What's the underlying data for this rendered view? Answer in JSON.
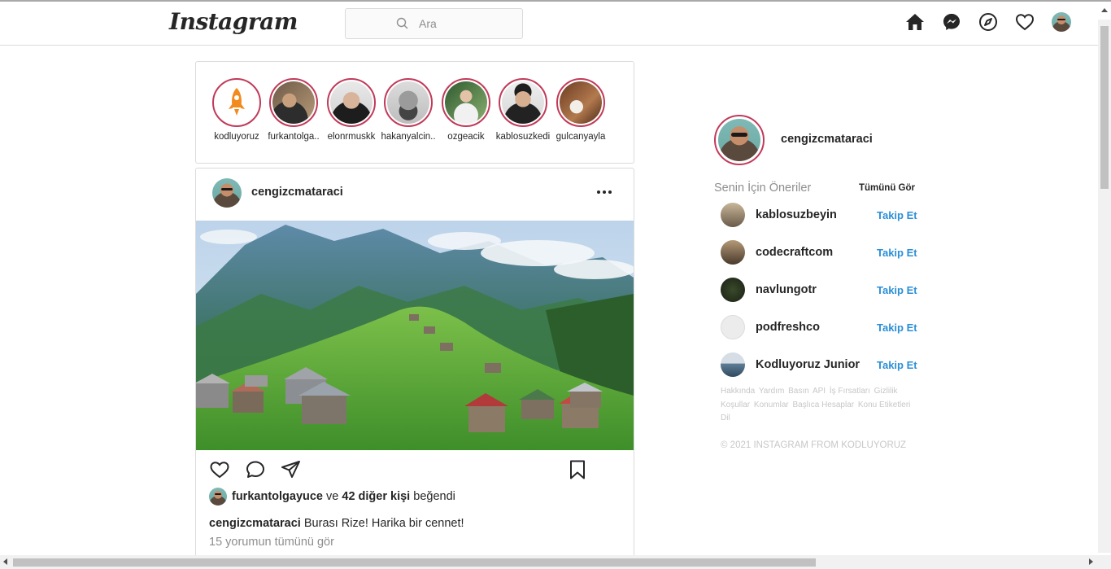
{
  "nav": {
    "logo": "Instagram",
    "search_placeholder": "Ara"
  },
  "stories": [
    {
      "name": "kodluyoruz",
      "kind": "rocket"
    },
    {
      "name": "furkantolga..",
      "kind": "photo"
    },
    {
      "name": "elonrmuskk",
      "kind": "photo"
    },
    {
      "name": "hakanyalcin..",
      "kind": "photo"
    },
    {
      "name": "ozgeacik",
      "kind": "photo"
    },
    {
      "name": "kablosuzkedi",
      "kind": "photo"
    },
    {
      "name": "gulcanyayla",
      "kind": "photo"
    }
  ],
  "post": {
    "user": "cengizcmataraci",
    "liked_by": "furkantolgayuce",
    "likes_connector": "ve",
    "likes_others": "42 diğer kişi",
    "likes_suffix": "beğendi",
    "caption_user": "cengizcmataraci",
    "caption_text": "Burası Rize! Harika bir cennet!",
    "comments_link": "15 yorumun tümünü gör"
  },
  "sidebar": {
    "me": "cengizcmataraci",
    "suggestions_title": "Senin İçin Öneriler",
    "see_all": "Tümünü Gör",
    "suggestions": [
      {
        "name": "kablosuzbeyin",
        "action": "Takip Et"
      },
      {
        "name": "codecraftcom",
        "action": "Takip Et"
      },
      {
        "name": "navlungotr",
        "action": "Takip Et"
      },
      {
        "name": "podfreshco",
        "action": "Takip Et"
      },
      {
        "name": "Kodluyoruz Junior",
        "action": "Takip Et"
      }
    ],
    "footer_links": [
      "Hakkında",
      "Yardım",
      "Basın",
      "API",
      "İş Fırsatları",
      "Gizlilik",
      "Koşullar",
      "Konumlar",
      "Başlıca Hesaplar",
      "Konu Etiketleri",
      "Dil"
    ],
    "copyright": "© 2021 INSTAGRAM FROM KODLUYORUZ"
  },
  "colors": {
    "story_ring": "#c13a5a",
    "link_blue": "#2b8fd6",
    "border": "#dbdbdb"
  }
}
